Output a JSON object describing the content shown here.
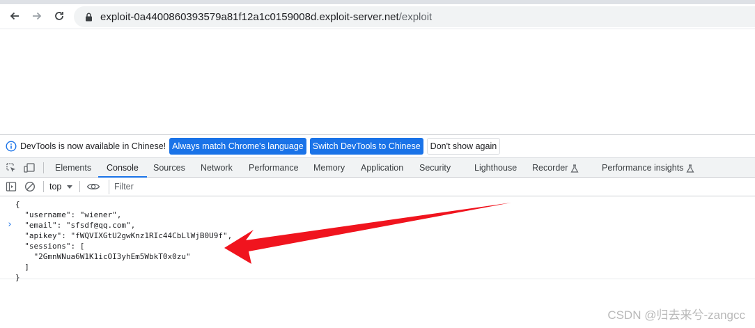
{
  "browser": {
    "url_host": "exploit-0a4400860393579a81f12a1c0159008d.exploit-server.net",
    "url_path": "/exploit",
    "icons": [
      "back-arrow-icon",
      "forward-arrow-icon",
      "reload-icon",
      "lock-icon"
    ]
  },
  "devtools": {
    "infobar": {
      "message": "DevTools is now available in Chinese!",
      "buttons": [
        "Always match Chrome's language",
        "Switch DevTools to Chinese",
        "Don't show again"
      ]
    },
    "tabs": [
      "Elements",
      "Console",
      "Sources",
      "Network",
      "Performance",
      "Memory",
      "Application",
      "Security",
      "Lighthouse",
      "Recorder",
      "Performance insights"
    ],
    "active_tab": "Console",
    "console_toolbar": {
      "context": "top",
      "filter_placeholder": "Filter"
    },
    "console_output": [
      "{",
      "  \"username\": \"wiener\",",
      "  \"email\": \"sfsdf@qq.com\",",
      "  \"apikey\": \"fWQVIXGtU2gwKnz1RIc44CbLlWjB0U9f\",",
      "  \"sessions\": [",
      "    \"2GmnWNua6W1K1icOI3yhEm5WbkT0x0zu\"",
      "  ]",
      "}"
    ],
    "prompt_symbol": "›"
  },
  "annotation": {
    "arrow_color": "#f0141e"
  },
  "watermark": "CSDN @归去来兮-zangcc",
  "colors": {
    "accent": "#1a73e8",
    "tab_underline": "#1a73e8"
  }
}
